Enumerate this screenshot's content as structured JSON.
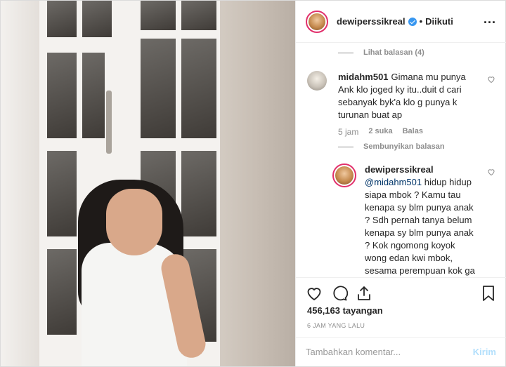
{
  "header": {
    "username": "dewiperssikreal",
    "separator": "•",
    "follow_status": "Diikuti",
    "more_label": "..."
  },
  "comments": {
    "view_replies_label": "Lihat balasan (4)",
    "comment1": {
      "username": "midahm501",
      "text": "Gimana mu punya Ank klo joged ky itu..duit d cari sebanyak byk'a klo g punya k turunan buat ap",
      "time": "5 jam",
      "likes": "2 suka",
      "reply_label": "Balas"
    },
    "hide_replies_label": "Sembunyikan balasan",
    "reply1": {
      "username": "dewiperssikreal",
      "mention": "@midahm501",
      "text": " hidup hidup siapa mbok ? Kamu tau kenapa sy blm punya anak ? Sdh pernah tanya belum kenapa sy blm punya anak ? Kok ngomong koyok wong edan kwi mbok, sesama perempuan kok ga bisa saling menjaga"
    }
  },
  "stats": {
    "views": "456,163 tayangan",
    "time_ago": "6 JAM YANG LALU"
  },
  "add_comment": {
    "placeholder": "Tambahkan komentar...",
    "post_label": "Kirim"
  },
  "colors": {
    "verified": "#3897f0",
    "story_ring": "#e1306c",
    "post_button_disabled": "#b2dffc"
  }
}
